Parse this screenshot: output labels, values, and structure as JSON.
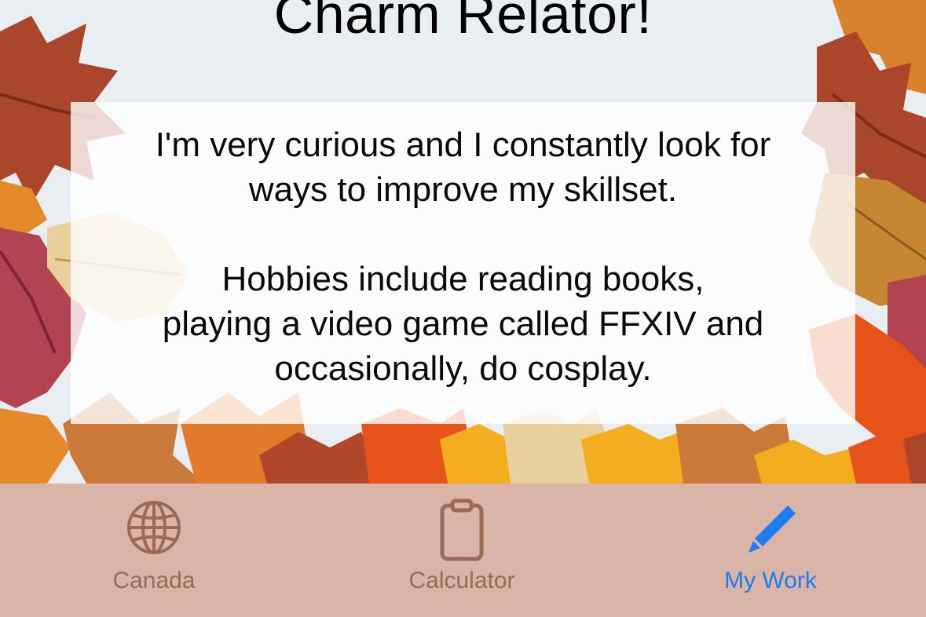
{
  "header": {
    "title": "Charm Relator!"
  },
  "bio": {
    "line1": "I'm very curious and I constantly look for",
    "line2": "ways to improve my skillset.",
    "line3": "Hobbies include reading books,",
    "line4": "playing a video game called FFXIV and",
    "line5": "occasionally, do cosplay."
  },
  "tabs": [
    {
      "label": "Canada",
      "icon": "globe-icon",
      "active": false
    },
    {
      "label": "Calculator",
      "icon": "clipboard-icon",
      "active": false
    },
    {
      "label": "My Work",
      "icon": "pencil-icon",
      "active": true
    }
  ],
  "colors": {
    "tabbar_bg": "#dab5a7",
    "inactive_tab": "#9b6a56",
    "active_tab": "#1f7cf0"
  }
}
